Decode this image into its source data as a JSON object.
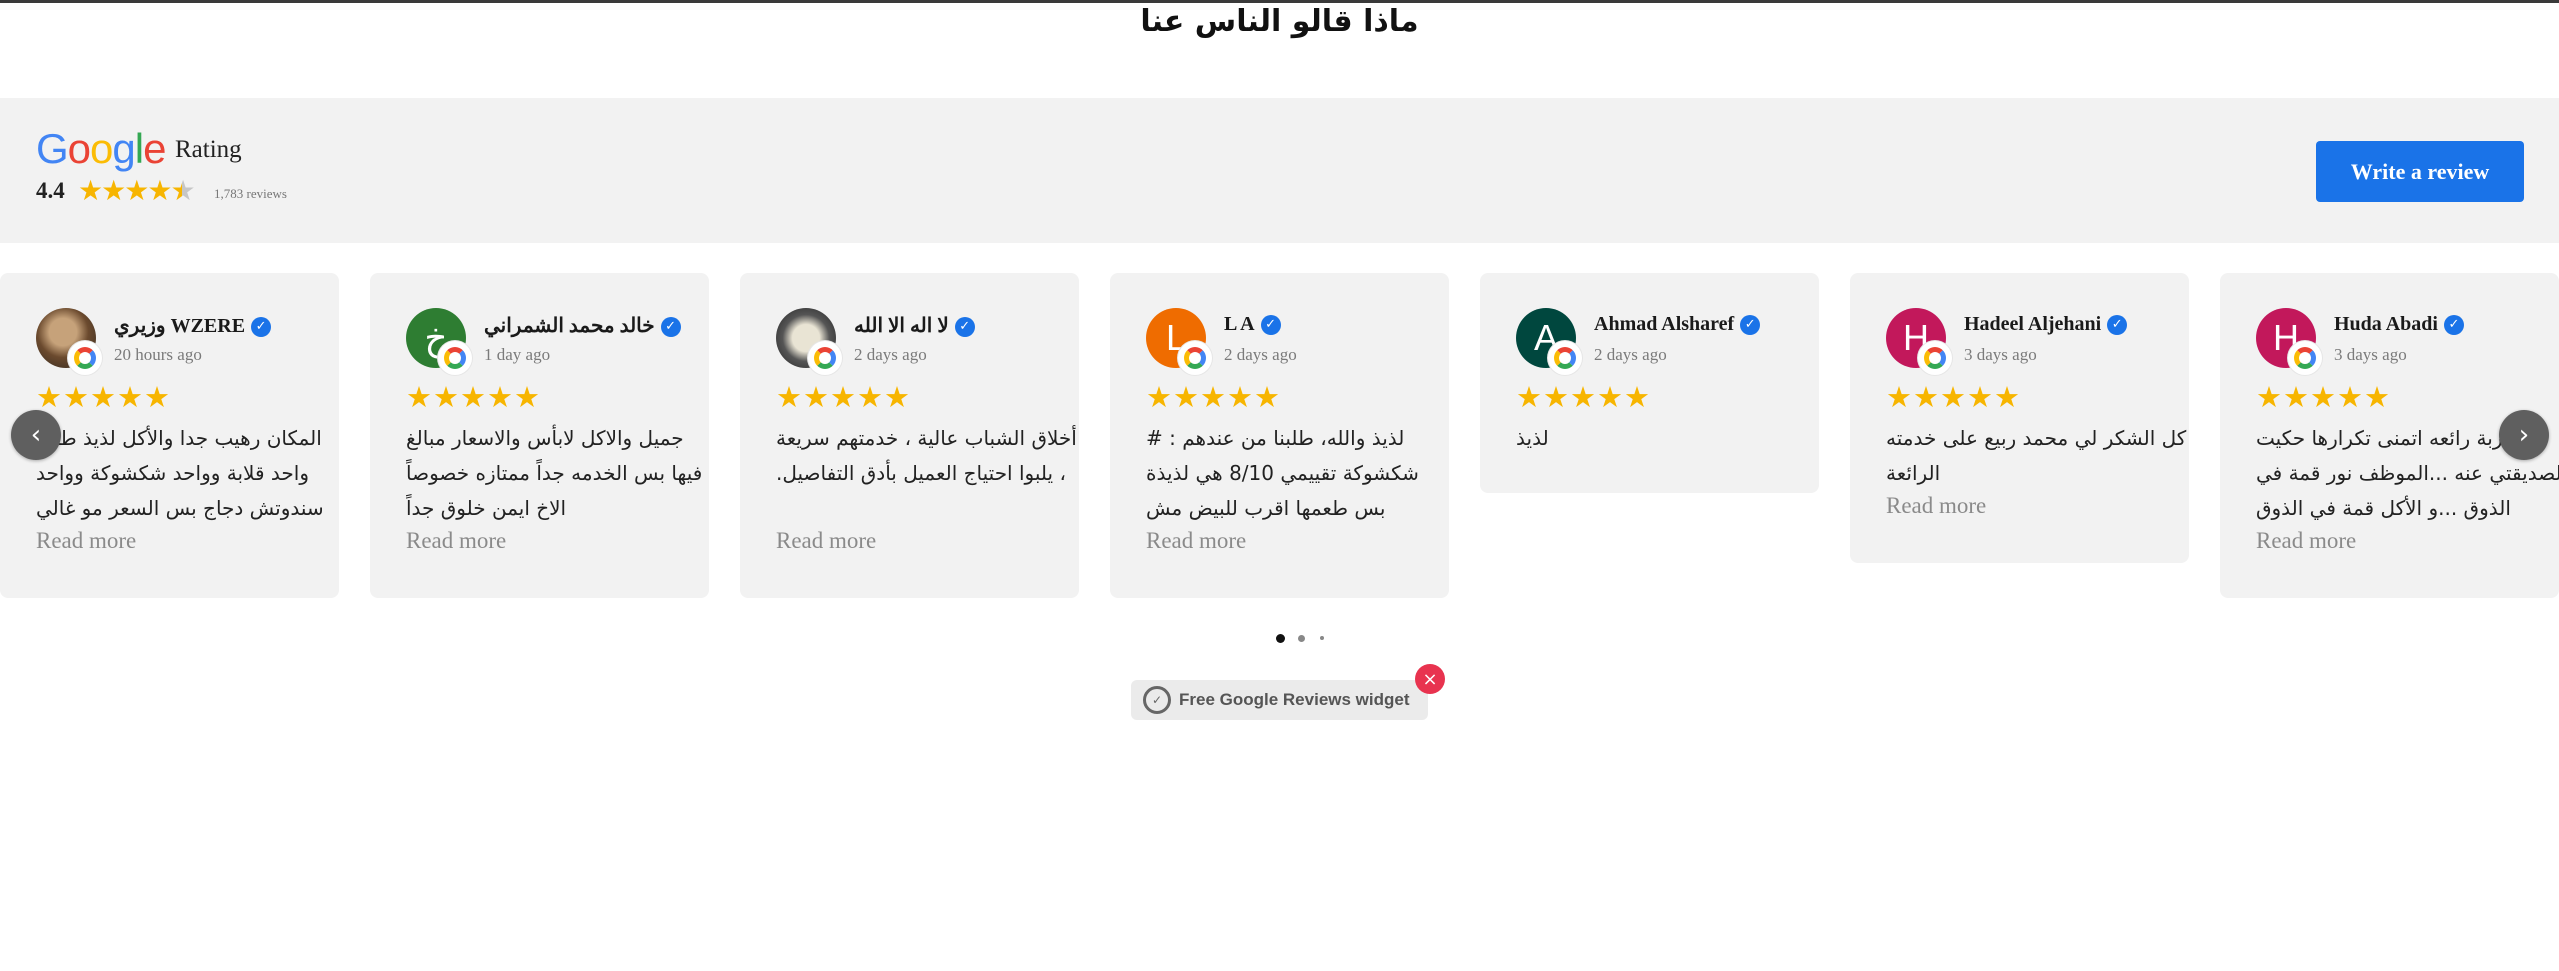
{
  "section": {
    "title": "ماذا قالو الناس عنا"
  },
  "summary": {
    "brand_letters": [
      "G",
      "o",
      "o",
      "g",
      "l",
      "e"
    ],
    "brand_colors": [
      "#4285f4",
      "#ea4335",
      "#fbbc05",
      "#4285f4",
      "#34a853",
      "#ea4335"
    ],
    "rating_label": "Rating",
    "rating_value": "4.4",
    "rating_stars": 4.4,
    "review_count_text": "1,783  reviews",
    "write_review_label": "Write a review"
  },
  "reviews": [
    {
      "name": "وزيري WZERE",
      "time": "20 hours ago",
      "stars": "★★★★★",
      "text": "المكان رهيب جدا والأكل لذيذ طلبنا واحد قلابة وواحد شكشوكة وواحد سندوتش دجاج بس السعر مو غالي",
      "read_more": "Read more",
      "avatar_letter": "",
      "avatar_color": ""
    },
    {
      "name": "خالد محمد الشمراني",
      "time": "1 day ago",
      "stars": "★★★★★",
      "text": "جميل والاكل لابأس والاسعار مبالغ فيها بس الخدمه جداً ممتازه خصوصاً الاخ ايمن خلوق جداً",
      "read_more": "Read more",
      "avatar_letter": "خ",
      "avatar_color": "#2e7d32"
    },
    {
      "name": "لا اله الا الله",
      "time": "2 days ago",
      "stars": "★★★★★",
      "text": "أخلاق الشباب عالية ، خدمتهم سريعة ، يلبوا احتياج العميل بأدق التفاصيل.",
      "read_more": "Read more",
      "avatar_letter": "",
      "avatar_color": ""
    },
    {
      "name": "L A",
      "time": "2 days ago",
      "stars": "★★★★★",
      "text": "لذيذ والله، طلبنا من عندهم : # شكشوكة تقييمي 8/10 هي لذيذة بس طعمها اقرب للبيض مش",
      "read_more": "Read more",
      "avatar_letter": "L",
      "avatar_color": "#ef6c00"
    },
    {
      "name": "Ahmad Alsharef",
      "time": "2 days ago",
      "stars": "★★★★★",
      "text": "لذيذ",
      "read_more": "",
      "avatar_letter": "A",
      "avatar_color": "#00473e"
    },
    {
      "name": "Hadeel Aljehani",
      "time": "3 days ago",
      "stars": "★★★★★",
      "text": "كل الشكر لي محمد ربيع على خدمته الرائعة",
      "read_more": "Read more",
      "avatar_letter": "H",
      "avatar_color": "#c2185b"
    },
    {
      "name": "Huda Abadi",
      "time": "3 days ago",
      "stars": "★★★★★",
      "text": "تجربة رائعه اتمنى تكرارها حكيت لصديقتي عنه ...الموظف نور قمة في الذوق ...و الأكل قمة في الذوق",
      "read_more": "Read more",
      "avatar_letter": "H",
      "avatar_color": "#c2185b"
    }
  ],
  "carousel": {
    "prev_icon": "‹",
    "next_icon": "›",
    "page_count": 3,
    "active_page": 1
  },
  "widget": {
    "label": "Free Google Reviews widget",
    "close_icon": "×"
  }
}
